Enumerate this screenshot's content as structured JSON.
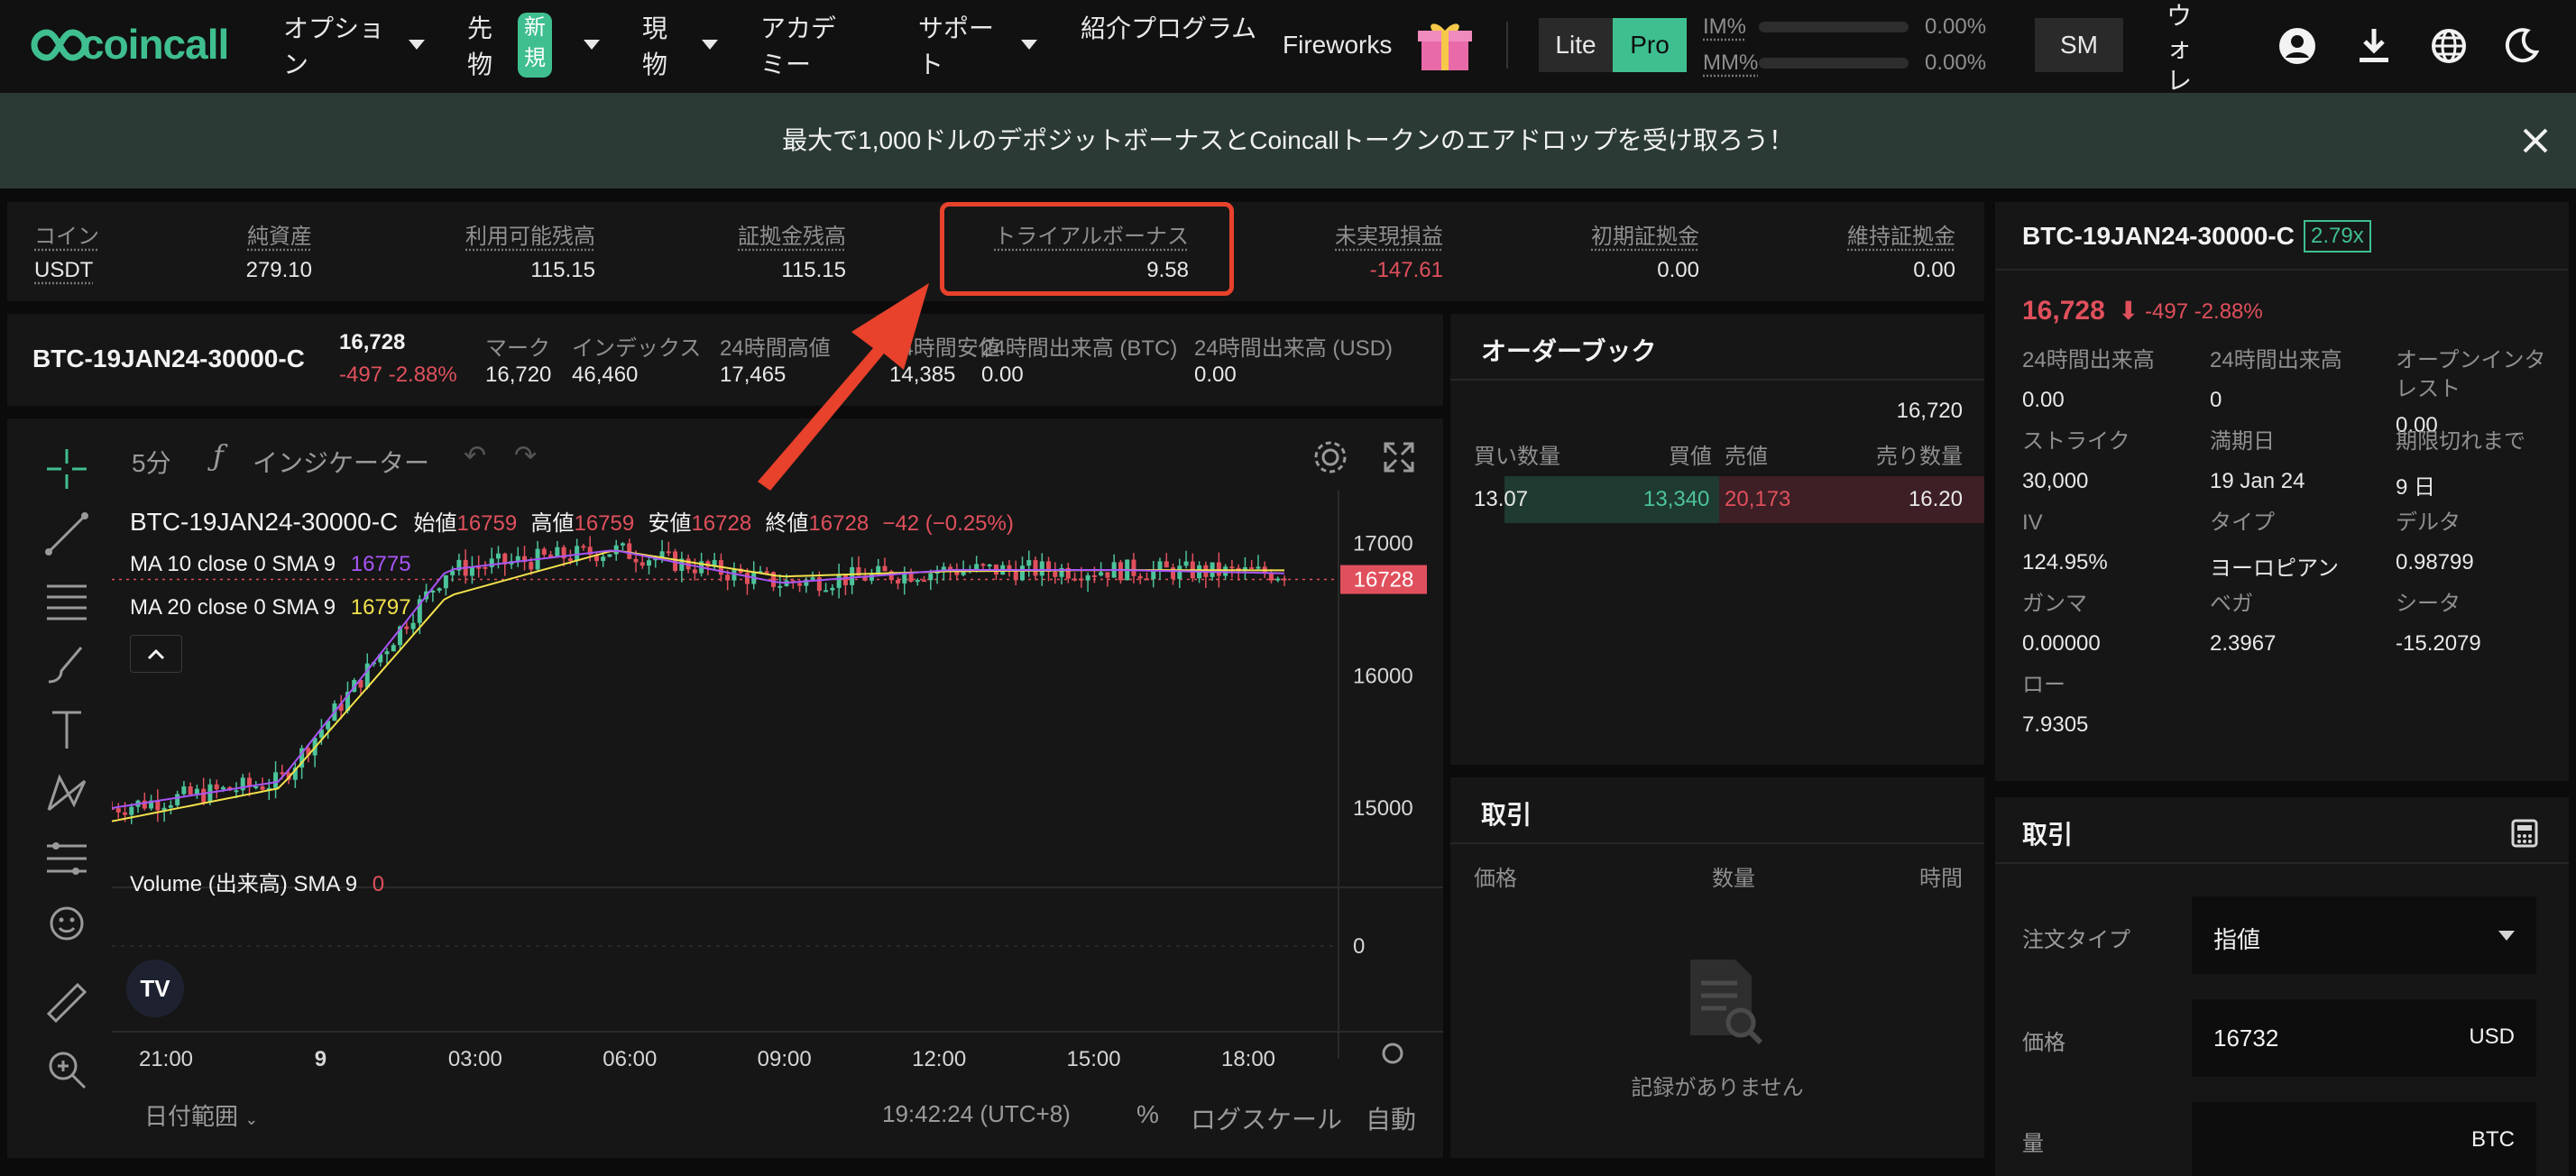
{
  "header": {
    "logo": "coincall",
    "nav": {
      "options": "オプション",
      "futures": "先物",
      "futures_badge": "新規",
      "spot": "現物",
      "academy": "アカデミー",
      "support": "サポート",
      "referral": "紹介プログラム",
      "fireworks": "Fireworks"
    },
    "mode_lite": "Lite",
    "mode_pro": "Pro",
    "im_label": "IM%",
    "im_value": "0.00%",
    "mm_label": "MM%",
    "mm_value": "0.00%",
    "user_initials": "SM",
    "wallet": "ウォレット"
  },
  "banner": {
    "text": "最大で1,000ドルのデポジットボーナスとCoincallトークンのエアドロップを受け取ろう！"
  },
  "account": {
    "cols": [
      {
        "label": "コイン",
        "value": "USDT"
      },
      {
        "label": "純資産",
        "value": "279.10"
      },
      {
        "label": "利用可能残高",
        "value": "115.15"
      },
      {
        "label": "証拠金残高",
        "value": "115.15"
      },
      {
        "label": "トライアルボーナス",
        "value": "9.58"
      },
      {
        "label": "未実現損益",
        "value": "-147.61"
      },
      {
        "label": "初期証拠金",
        "value": "0.00"
      },
      {
        "label": "維持証拠金",
        "value": "0.00"
      }
    ]
  },
  "ticker": {
    "symbol": "BTC-19JAN24-30000-C",
    "last": "16,728",
    "change": "-497 -2.88%",
    "stats": [
      {
        "label": "マーク",
        "value": "16,720"
      },
      {
        "label": "インデックス",
        "value": "46,460"
      },
      {
        "label": "24時間高値",
        "value": "17,465"
      },
      {
        "label": "24時間安値",
        "value": "14,385"
      },
      {
        "label": "24時間出来高 (BTC)",
        "value": "0.00"
      },
      {
        "label": "24時間出来高 (USD)",
        "value": "0.00"
      }
    ]
  },
  "chart": {
    "interval": "5分",
    "indicators": "インジケーター",
    "legend_symbol": "BTC-19JAN24-30000-C",
    "ohlc": {
      "open_label": "始値",
      "open": "16759",
      "high_label": "高値",
      "high": "16759",
      "low_label": "安値",
      "low": "16728",
      "close_label": "終値",
      "close": "16728",
      "change": "−42 (−0.25%)"
    },
    "ma10_label": "MA 10 close 0 SMA 9",
    "ma10_value": "16775",
    "ma20_label": "MA 20 close 0 SMA 9",
    "ma20_value": "16797",
    "volume_label": "Volume (出来高) SMA 9",
    "volume_value": "0",
    "price_tag": "16728",
    "y_ticks": [
      "17000",
      "16000",
      "15000"
    ],
    "vol_tick": "0",
    "x_ticks": [
      "21:00",
      "9",
      "03:00",
      "06:00",
      "09:00",
      "12:00",
      "15:00",
      "18:00"
    ],
    "date_range": "日付範囲",
    "clock": "19:42:24 (UTC+8)",
    "percent": "%",
    "log_scale": "ログスケール",
    "auto": "自動",
    "colors": {
      "up": "#4cc39a",
      "down": "#e0505c",
      "ma10": "#a855f7",
      "ma20": "#f2e24b"
    }
  },
  "chart_data": {
    "type": "line",
    "title": "BTC-19JAN24-30000-C",
    "x": [
      "21:00",
      "9",
      "03:00",
      "06:00",
      "09:00",
      "12:00",
      "15:00",
      "18:00"
    ],
    "series": [
      {
        "name": "MA 10 close 0 SMA 9",
        "values": [
          15000,
          15200,
          16800,
          16950,
          16700,
          16800,
          16800,
          16775
        ]
      },
      {
        "name": "MA 20 close 0 SMA 9",
        "values": [
          14900,
          15150,
          16600,
          16950,
          16750,
          16790,
          16800,
          16797
        ]
      }
    ],
    "ylim": [
      14400,
      17400
    ]
  },
  "orderbook": {
    "title": "オーダーブック",
    "mark": "16,720",
    "headers": [
      "買い数量",
      "買値",
      "売値",
      "売り数量"
    ],
    "rows": [
      {
        "bid_qty": "13.07",
        "bid": "13,340",
        "ask": "20,173",
        "ask_qty": "16.20"
      }
    ]
  },
  "trades": {
    "title": "取引",
    "headers": [
      "価格",
      "数量",
      "時間"
    ],
    "empty": "記録がありません"
  },
  "instrument": {
    "symbol": "BTC-19JAN24-30000-C",
    "leverage": "2.79x",
    "price": "16,728",
    "change": "-497 -2.88%",
    "fields": [
      {
        "label": "24時間出来高",
        "value": "0.00"
      },
      {
        "label": "24時間出来高",
        "value": "0"
      },
      {
        "label": "オープンインタレスト",
        "value": "0.00"
      },
      {
        "label": "ストライク",
        "value": "30,000"
      },
      {
        "label": "満期日",
        "value": "19 Jan 24"
      },
      {
        "label": "期限切れまで",
        "value": "9 日"
      },
      {
        "label": "IV",
        "value": "124.95%"
      },
      {
        "label": "タイプ",
        "value": "ヨーロピアン"
      },
      {
        "label": "デルタ",
        "value": "0.98799"
      },
      {
        "label": "ガンマ",
        "value": "0.00000"
      },
      {
        "label": "ベガ",
        "value": "2.3967"
      },
      {
        "label": "シータ",
        "value": "-15.2079"
      },
      {
        "label": "ロー",
        "value": "7.9305"
      }
    ]
  },
  "trade_form": {
    "title": "取引",
    "order_type_label": "注文タイプ",
    "order_type_value": "指値",
    "price_label": "価格",
    "price_value": "16732",
    "price_unit": "USD",
    "qty_label": "量",
    "qty_unit": "BTC"
  }
}
